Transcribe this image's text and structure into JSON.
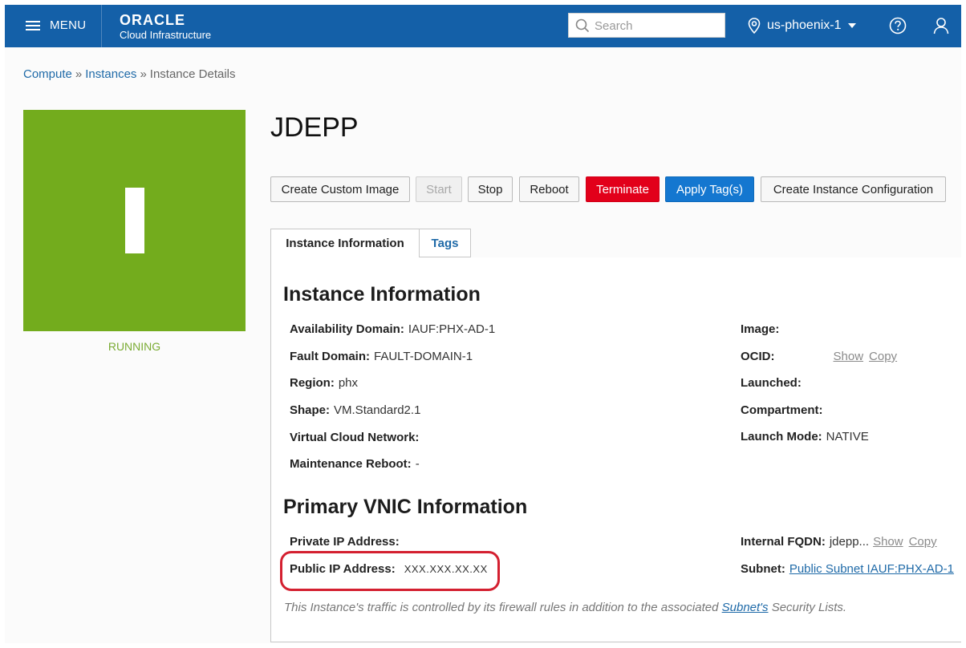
{
  "topbar": {
    "menu_label": "MENU",
    "logo_line1": "ORACLE",
    "logo_line2": "Cloud Infrastructure",
    "search_placeholder": "Search",
    "region": "us-phoenix-1"
  },
  "breadcrumb": {
    "items": [
      "Compute",
      "Instances"
    ],
    "current": "Instance Details",
    "separator": "»"
  },
  "instance": {
    "status": "RUNNING",
    "status_color": "#73ac1d",
    "name": "JDEPP"
  },
  "actions": {
    "create_custom_image": "Create Custom Image",
    "start": "Start",
    "stop": "Stop",
    "reboot": "Reboot",
    "terminate": "Terminate",
    "apply_tags": "Apply Tag(s)",
    "create_instance_configuration": "Create Instance Configuration"
  },
  "tabs": {
    "instance_information": "Instance Information",
    "tags": "Tags"
  },
  "instance_info": {
    "heading": "Instance Information",
    "availability_domain": {
      "label": "Availability Domain:",
      "value": "IAUF:PHX-AD-1"
    },
    "fault_domain": {
      "label": "Fault Domain:",
      "value": "FAULT-DOMAIN-1"
    },
    "region": {
      "label": "Region:",
      "value": "phx"
    },
    "shape": {
      "label": "Shape:",
      "value": "VM.Standard2.1"
    },
    "vcn": {
      "label": "Virtual Cloud Network:"
    },
    "maintenance_reboot": {
      "label": "Maintenance Reboot:",
      "value": "-"
    },
    "image": {
      "label": "Image:"
    },
    "ocid": {
      "label": "OCID:",
      "show": "Show",
      "copy": "Copy"
    },
    "launched": {
      "label": "Launched:"
    },
    "compartment": {
      "label": "Compartment:"
    },
    "launch_mode": {
      "label": "Launch Mode:",
      "value": "NATIVE"
    }
  },
  "vnic_info": {
    "heading": "Primary VNIC Information",
    "private_ip": {
      "label": "Private IP Address:"
    },
    "public_ip": {
      "label": "Public IP Address:",
      "value": "XXX.XXX.XX.XX"
    },
    "internal_fqdn": {
      "label": "Internal FQDN:",
      "value": "jdepp...",
      "show": "Show",
      "copy": "Copy"
    },
    "subnet": {
      "label": "Subnet:",
      "value": "Public Subnet IAUF:PHX-AD-1"
    },
    "note_before": "This Instance's traffic is controlled by its firewall rules in addition to the associated ",
    "note_link": "Subnet's",
    "note_after": " Security Lists."
  }
}
